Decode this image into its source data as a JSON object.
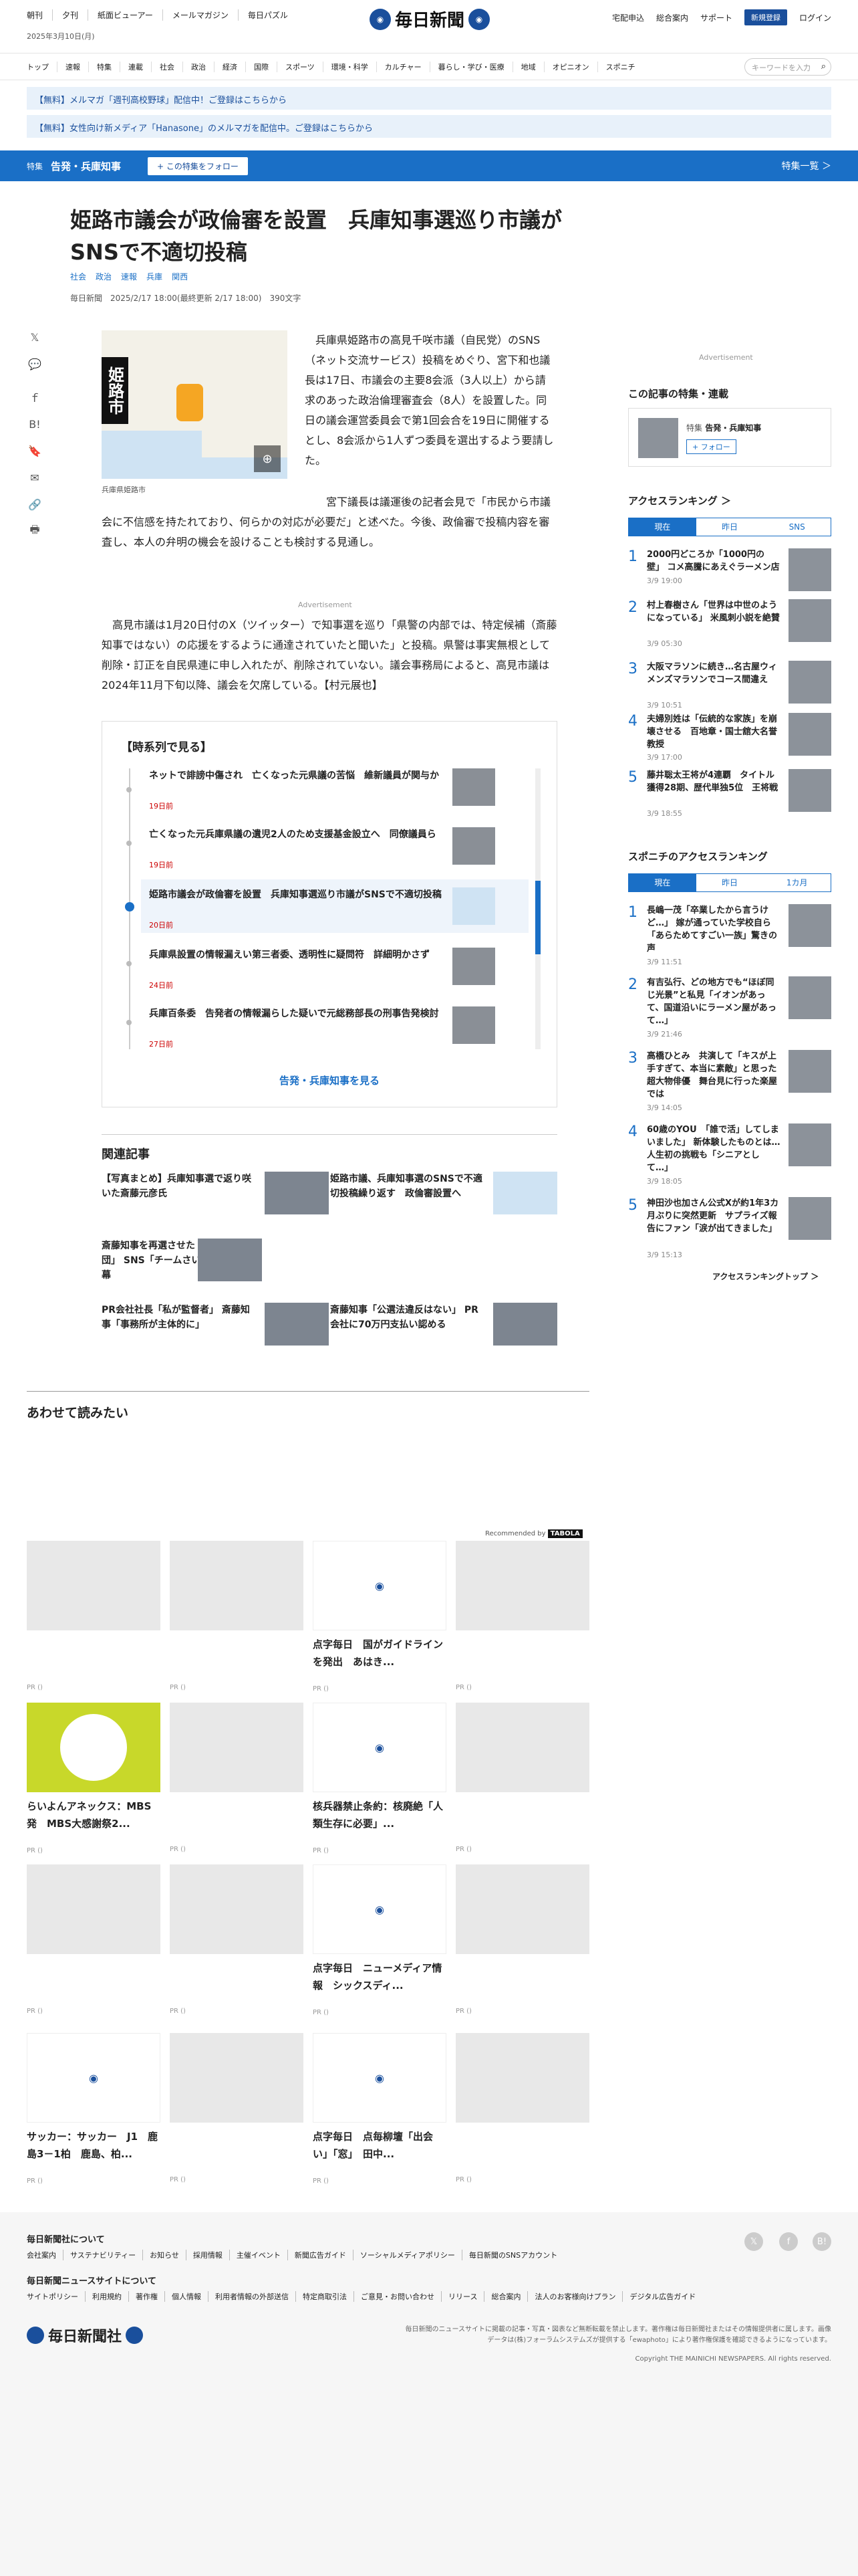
{
  "header": {
    "links": [
      "朝刊",
      "夕刊",
      "紙面ビューアー",
      "メールマガジン",
      "毎日パズル"
    ],
    "date": "2025年3月10日(月)",
    "logo": "毎日新聞",
    "right_links": [
      "宅配申込",
      "総合案内",
      "サポート"
    ],
    "register": "新規登録",
    "login": "ログイン"
  },
  "nav": [
    "トップ",
    "速報",
    "特集",
    "連載",
    "社会",
    "政治",
    "経済",
    "国際",
    "スポーツ",
    "環境・科学",
    "カルチャー",
    "暮らし・学び・医療",
    "地域",
    "オピニオン",
    "スポニチ"
  ],
  "search_placeholder": "キーワードを入力",
  "banners": [
    "【無料】メルマガ「週刊高校野球」配信中！ご登録はこちらから",
    "【無料】女性向け新メディア「Hanasone」のメルマガを配信中。ご登録はこちらから"
  ],
  "topic": {
    "label": "特集",
    "name": "告発・兵庫知事",
    "follow": "+ この特集をフォロー",
    "more": "特集一覧 ＞"
  },
  "article": {
    "title": "姫路市議会が政倫審を設置　兵庫知事選巡り市議がSNSで不適切投稿",
    "tags": [
      "社会",
      "政治",
      "速報",
      "兵庫",
      "関西"
    ],
    "meta": "毎日新聞　2025/2/17 18:00(最終更新 2/17 18:00)　390文字",
    "map_label": "姫路市",
    "map_caption": "兵庫県姫路市",
    "p1": "兵庫県姫路市の高見千咲市議（自民党）のSNS（ネット交流サービス）投稿をめぐり、宮下和也議長は17日、市議会の主要8会派（3人以上）から請求のあった政治倫理審査会（8人）を設置した。同日の議会運営委員会で第1回会合を19日に開催するとし、8会派から1人ずつ委員を選出するよう要請した。",
    "p2": "宮下議長は議運後の記者会見で「市民から市議会に不信感を持たれており、何らかの対応が必要だ」と述べた。今後、政倫審で投稿内容を審査し、本人の弁明の機会を設けることも検討する見通し。",
    "advertisement": "Advertisement",
    "p3": "高見市議は1月20日付のX（ツイッター）で知事選を巡り「県警の内部では、特定候補（斎藤知事ではない）の応援をするように通達されていたと聞いた」と投稿。県警は事実無根として削除・訂正を自民県連に申し入れたが、削除されていない。議会事務局によると、高見市議は2024年11月下旬以降、議会を欠席している。【村元展也】"
  },
  "timeline": {
    "heading": "【時系列で見る】",
    "items": [
      {
        "title": "ネットで誹謗中傷され　亡くなった元県議の苦悩　維新議員が関与か",
        "date": "19日前"
      },
      {
        "title": "亡くなった元兵庫県議の遺児2人のため支援基金設立へ　同僚議員ら",
        "date": "19日前"
      },
      {
        "title": "姫路市議会が政倫審を設置　兵庫知事選巡り市議がSNSで不適切投稿",
        "date": "20日前"
      },
      {
        "title": "兵庫県設置の情報漏えい第三者委、透明性に疑問符　詳細明かさず",
        "date": "24日前"
      },
      {
        "title": "兵庫百条委　告発者の情報漏らした疑いで元総務部長の刑事告発検討",
        "date": "27日前"
      }
    ],
    "more": "告発・兵庫知事を見る"
  },
  "related": {
    "heading": "関連記事",
    "items": [
      "【写真まとめ】兵庫知事選で返り咲いた斎藤元彦氏",
      "姫路市議、兵庫知事選のSNSで不適切投稿繰り返す　政倫審設置へ",
      "斎藤知事を再選させた「素人集団」 SNS「チームさいとう」の内幕",
      "PR会社社長「私が監督者」 斎藤知事「事務所が主体的に」",
      "斎藤知事「公選法違反はない」 PR会社に70万円支払い認める"
    ]
  },
  "sidebar": {
    "advertisement": "Advertisement",
    "series_heading": "この記事の特集・連載",
    "series_label": "特集",
    "series_name": "告発・兵庫知事",
    "series_follow": "+ フォロー",
    "ranking_heading": "アクセスランキング ＞",
    "ranking_tabs": [
      "現在",
      "昨日",
      "SNS"
    ],
    "ranking": [
      {
        "n": "1",
        "t": "2000円どころか「1000円の壁」 コメ高騰にあえぐラーメン店",
        "tm": "3/9 19:00"
      },
      {
        "n": "2",
        "t": "村上春樹さん「世界は中世のようになっている」 米風刺小説を絶賛",
        "tm": "3/9 05:30"
      },
      {
        "n": "3",
        "t": "大阪マラソンに続き…名古屋ウィメンズマラソンでコース間違え",
        "tm": "3/9 10:51"
      },
      {
        "n": "4",
        "t": "夫婦別姓は「伝統的な家族」を崩壊させる　百地章・国士舘大名誉教授",
        "tm": "3/9 17:00"
      },
      {
        "n": "5",
        "t": "藤井聡太王将が4連覇　タイトル獲得28期、歴代単独5位　王将戦",
        "tm": "3/9 18:55"
      }
    ],
    "sponichi_heading": "スポニチのアクセスランキング",
    "sponichi_tabs": [
      "現在",
      "昨日",
      "1カ月"
    ],
    "sponichi": [
      {
        "n": "1",
        "t": "長嶋一茂「卒業したから言うけど…」 嫁が通っていた学校自ら「あらためてすごい一族」驚きの声",
        "tm": "3/9 11:51"
      },
      {
        "n": "2",
        "t": "有吉弘行、どの地方でも“ほぼ同じ光景”と私見「イオンがあって、国道沿いにラーメン屋があって…」",
        "tm": "3/9 21:46"
      },
      {
        "n": "3",
        "t": "高橋ひとみ　共演して「キスが上手すぎて、本当に素敵」と思った超大物俳優　舞台見に行った楽屋では",
        "tm": "3/9 14:05"
      },
      {
        "n": "4",
        "t": "60歳のYOU　「誰で活」してしまいました」 新体験したものとは…人生初の挑戦も「シニアとして…」",
        "tm": "3/9 18:05"
      },
      {
        "n": "5",
        "t": "神田沙也加さん公式Xが約1年3カ月ぶりに突然更新　サプライズ報告にファン「涙が出てきました」",
        "tm": "3/9 15:13"
      }
    ],
    "ranking_top": "アクセスランキングトップ ＞"
  },
  "recommend": {
    "heading": "あわせて読みたい",
    "by": "Recommended by",
    "brand": "TABOLA",
    "pr": "PR ()",
    "cards": [
      "",
      "",
      "点字毎日　国がガイドラインを発出　あはき...",
      "",
      "らいよんアネックス：MBS発　MBS大感謝祭2...",
      "",
      "核兵器禁止条約：核廃絶「人類生存に必要」...",
      "",
      "",
      "",
      "点字毎日　ニューメディア情報　シックスディ...",
      "",
      "サッカー：サッカー　J1　鹿島3－1柏　鹿島、柏...",
      "",
      "点字毎日　点毎柳壇「出会い」「窓」　田中...",
      ""
    ]
  },
  "footer": {
    "h1": "毎日新聞社について",
    "links1": [
      "会社案内",
      "サステナビリティー",
      "お知らせ",
      "採用情報",
      "主催イベント",
      "新聞広告ガイド",
      "ソーシャルメディアポリシー",
      "毎日新聞のSNSアカウント"
    ],
    "h2": "毎日新聞ニュースサイトについて",
    "links2": [
      "サイトポリシー",
      "利用規約",
      "著作権",
      "個人情報",
      "利用者情報の外部送信",
      "特定商取引法",
      "ご意見・お問い合わせ",
      "リリース",
      "総合案内",
      "法人のお客様向けプラン",
      "デジタル広告ガイド"
    ],
    "notice": "毎日新聞のニュースサイトに掲載の記事・写真・図表など無断転載を禁止します。著作権は毎日新聞社またはその情報提供者に属します。画像データは(株)フォーラムシステムズが提供する「ewaphoto」により著作権保護を確認できるようになっています。",
    "copyright": "Copyright THE MAINICHI NEWSPAPERS. All rights reserved.",
    "logo": "毎日新聞社"
  }
}
